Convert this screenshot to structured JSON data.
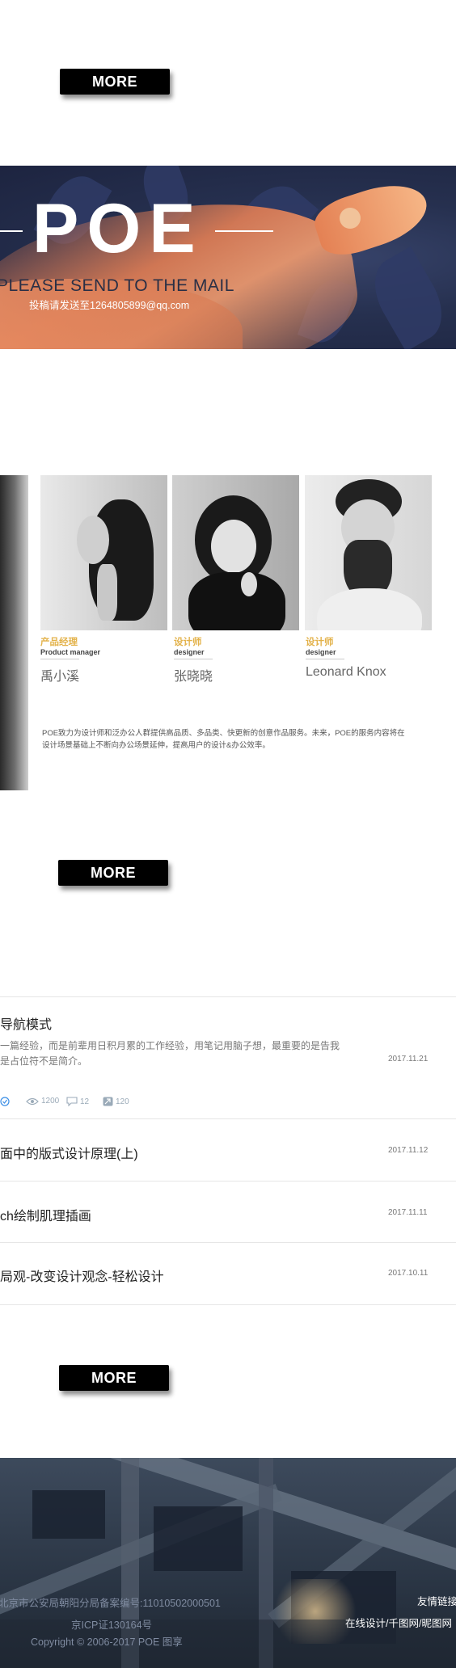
{
  "buttons": {
    "more_label": "MORE"
  },
  "banner": {
    "title": "POE",
    "mail_en": "PLEASE SEND TO THE MAIL",
    "mail_cn": "投稿请发送至1264805899@qq.com"
  },
  "team": {
    "members": [
      {
        "role_cn": "产品经理",
        "role_en": "Product manager",
        "name": "禹小溪"
      },
      {
        "role_cn": "设计师",
        "role_en": "designer",
        "name": "张晓晓"
      },
      {
        "role_cn": "设计师",
        "role_en": "designer",
        "name": "Leonard Knox"
      }
    ],
    "description": "POE致力为设计师和泛办公人群提供高品质、多品类、快更新的创意作品服务。未来，POE的服务内容将在设计场景基础上不断向办公场景延伸，提高用户的设计&办公效率。"
  },
  "articles": {
    "featured": {
      "title": "导航模式",
      "excerpt": "一篇经验，而是前辈用日积月累的工作经验，用笔记用脑子想，最重要的是告我是占位符不是简介。",
      "date": "2017.11.21",
      "views": "1200",
      "comments": "12",
      "shares": "120"
    },
    "items": [
      {
        "title": "面中的版式设计原理(上)",
        "date": "2017.11.12"
      },
      {
        "title": "ch绘制肌理插画",
        "date": "2017.11.11"
      },
      {
        "title": "局观-改变设计观念-轻松设计",
        "date": "2017.10.11"
      }
    ]
  },
  "footer": {
    "icp_police": "北京市公安局朝阳分局备案编号:110105020005​01",
    "icp": "京ICP证130164号",
    "copyright": "Copyright © 2006-2017 POE 图享",
    "links_title": "友情链接",
    "links": "在线设计/千图网/昵图网"
  }
}
